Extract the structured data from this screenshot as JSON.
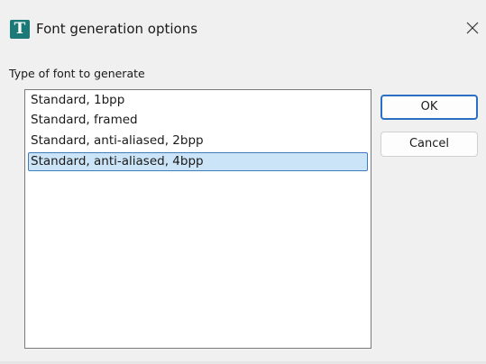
{
  "window": {
    "title": "Font generation options",
    "icon": "T",
    "icon_color": "#1b7a78"
  },
  "group": {
    "label": "Type of font to generate"
  },
  "font_types": {
    "items": [
      "Standard, 1bpp",
      "Standard, framed",
      "Standard, anti-aliased, 2bpp",
      "Standard, anti-aliased, 4bpp"
    ],
    "selected_index": 3
  },
  "buttons": {
    "ok_label": "OK",
    "cancel_label": "Cancel"
  },
  "colors": {
    "selection_bg": "#cce4f7",
    "selection_border": "#3f7dc0",
    "default_button_border": "#2a6fc4"
  }
}
